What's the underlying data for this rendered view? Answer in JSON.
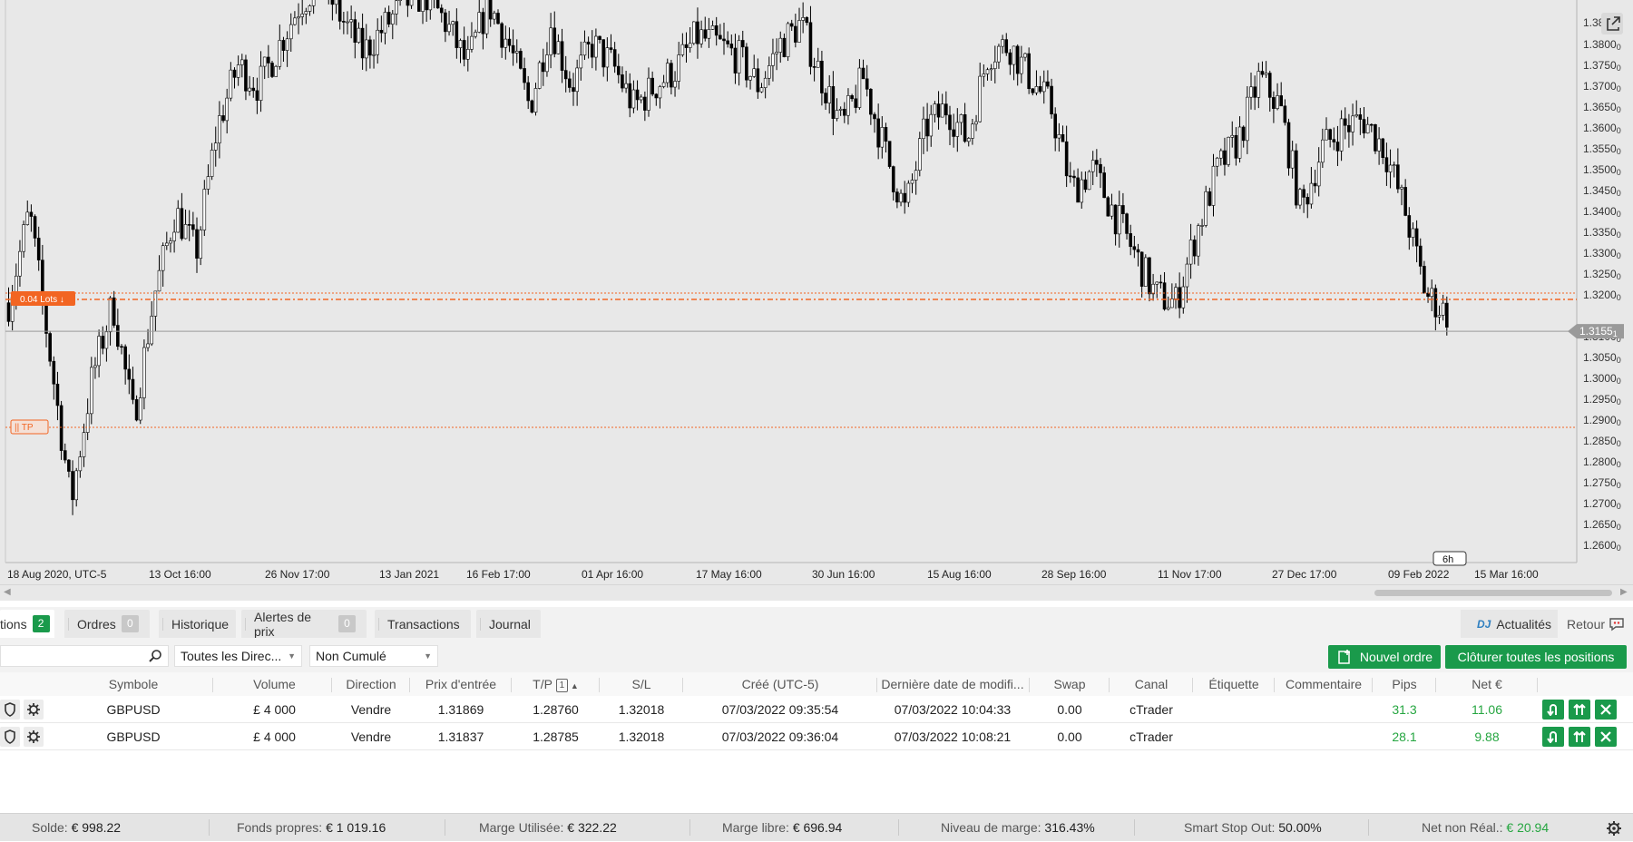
{
  "chart": {
    "symbol": "GBPUSD",
    "timeframe_badge": "6h",
    "current_price_label": "1.3155",
    "current_price_suffix": "1",
    "position_label": "0.04 Lots",
    "tp_label": "TP",
    "y_axis_labels": [
      {
        "text": "1.38",
        "sub": "0"
      },
      {
        "text": "1.3800",
        "sub": "0"
      },
      {
        "text": "1.3750",
        "sub": "0"
      },
      {
        "text": "1.3700",
        "sub": "0"
      },
      {
        "text": "1.3650",
        "sub": "0"
      },
      {
        "text": "1.3600",
        "sub": "0"
      },
      {
        "text": "1.3550",
        "sub": "0"
      },
      {
        "text": "1.3500",
        "sub": "0"
      },
      {
        "text": "1.3450",
        "sub": "0"
      },
      {
        "text": "1.3400",
        "sub": "0"
      },
      {
        "text": "1.3350",
        "sub": "0"
      },
      {
        "text": "1.3300",
        "sub": "0"
      },
      {
        "text": "1.3250",
        "sub": "0"
      },
      {
        "text": "1.3200",
        "sub": "0"
      },
      {
        "text": "1.3100",
        "sub": "0"
      },
      {
        "text": "1.3050",
        "sub": "0"
      },
      {
        "text": "1.3000",
        "sub": "0"
      },
      {
        "text": "1.2950",
        "sub": "0"
      },
      {
        "text": "1.2900",
        "sub": "0"
      },
      {
        "text": "1.2850",
        "sub": "0"
      },
      {
        "text": "1.2800",
        "sub": "0"
      },
      {
        "text": "1.2750",
        "sub": "0"
      },
      {
        "text": "1.2700",
        "sub": "0"
      },
      {
        "text": "1.2650",
        "sub": "0"
      },
      {
        "text": "1.2600",
        "sub": "0"
      }
    ],
    "x_axis_labels": [
      "18 Aug 2020, UTC-5",
      "13 Oct 16:00",
      "26 Nov 17:00",
      "13 Jan 2021",
      "16 Feb 17:00",
      "01 Apr 16:00",
      "17 May 16:00",
      "30 Jun 16:00",
      "15 Aug 16:00",
      "28 Sep 16:00",
      "11 Nov 17:00",
      "27 Dec 17:00",
      "09 Feb 2022",
      "15 Mar 16:00"
    ],
    "close_path": [
      1.318,
      1.34,
      1.305,
      1.27,
      1.3,
      1.318,
      1.29,
      1.32,
      1.34,
      1.33,
      1.36,
      1.375,
      1.37,
      1.38,
      1.39,
      1.395,
      1.386,
      1.378,
      1.384,
      1.39,
      1.392,
      1.385,
      1.375,
      1.39,
      1.38,
      1.365,
      1.385,
      1.37,
      1.38,
      1.375,
      1.365,
      1.37,
      1.374,
      1.382,
      1.38,
      1.377,
      1.37,
      1.38,
      1.385,
      1.372,
      1.36,
      1.372,
      1.355,
      1.34,
      1.36,
      1.365,
      1.357,
      1.378,
      1.38,
      1.372,
      1.365,
      1.345,
      1.35,
      1.34,
      1.33,
      1.32,
      1.318,
      1.335,
      1.35,
      1.357,
      1.372,
      1.365,
      1.34,
      1.355,
      1.36,
      1.362,
      1.355,
      1.34,
      1.32,
      1.3155
    ],
    "colors": {
      "bull": "#ffffff",
      "bear": "#000000",
      "order": "#f26522",
      "price_line": "#9a9a9a"
    }
  },
  "tabs": {
    "positions": {
      "label": "tions",
      "count": "2"
    },
    "orders": {
      "label": "Ordres",
      "count": "0"
    },
    "history": {
      "label": "Historique"
    },
    "alerts": {
      "label": "Alertes de prix",
      "count": "0"
    },
    "transactions": {
      "label": "Transactions"
    },
    "journal": {
      "label": "Journal"
    },
    "news": {
      "prefix": "DJ",
      "label": "Actualités"
    },
    "retour": {
      "label": "Retour"
    }
  },
  "toolbar": {
    "search_value": "",
    "direction_filter": "Toutes les Direc...",
    "cumul_filter": "Non Cumulé",
    "new_order_label": "Nouvel ordre",
    "close_all_label": "Clôturer toutes les positions"
  },
  "table": {
    "columns": {
      "symbol": "Symbole",
      "volume": "Volume",
      "direction": "Direction",
      "entry": "Prix d'entrée",
      "tp": "T/P",
      "tp_sort": "1",
      "sl": "S/L",
      "created": "Créé (UTC-5)",
      "modified": "Dernière date de modifi...",
      "swap": "Swap",
      "channel": "Canal",
      "label": "Étiquette",
      "comment": "Commentaire",
      "pips": "Pips",
      "net": "Net €"
    },
    "rows": [
      {
        "symbol": "GBPUSD",
        "volume": "£ 4 000",
        "direction": "Vendre",
        "entry": "1.31869",
        "tp": "1.28760",
        "sl": "1.32018",
        "created": "07/03/2022 09:35:54",
        "modified": "07/03/2022 10:04:33",
        "swap": "0.00",
        "channel": "cTrader",
        "label": "",
        "comment": "",
        "pips": "31.3",
        "net": "11.06"
      },
      {
        "symbol": "GBPUSD",
        "volume": "£ 4 000",
        "direction": "Vendre",
        "entry": "1.31837",
        "tp": "1.28785",
        "sl": "1.32018",
        "created": "07/03/2022 09:36:04",
        "modified": "07/03/2022 10:08:21",
        "swap": "0.00",
        "channel": "cTrader",
        "label": "",
        "comment": "",
        "pips": "28.1",
        "net": "9.88"
      }
    ]
  },
  "status": {
    "balance_label": "Solde:",
    "balance_value": "€ 998.22",
    "equity_label": "Fonds propres:",
    "equity_value": "€ 1 019.16",
    "used_margin_label": "Marge Utilisée:",
    "used_margin_value": "€ 322.22",
    "free_margin_label": "Marge libre:",
    "free_margin_value": "€ 696.94",
    "margin_level_label": "Niveau de marge:",
    "margin_level_value": "316.43%",
    "stop_out_label": "Smart Stop Out:",
    "stop_out_value": "50.00%",
    "unrealized_label": "Net non Réal.:",
    "unrealized_value": "€ 20.94"
  }
}
